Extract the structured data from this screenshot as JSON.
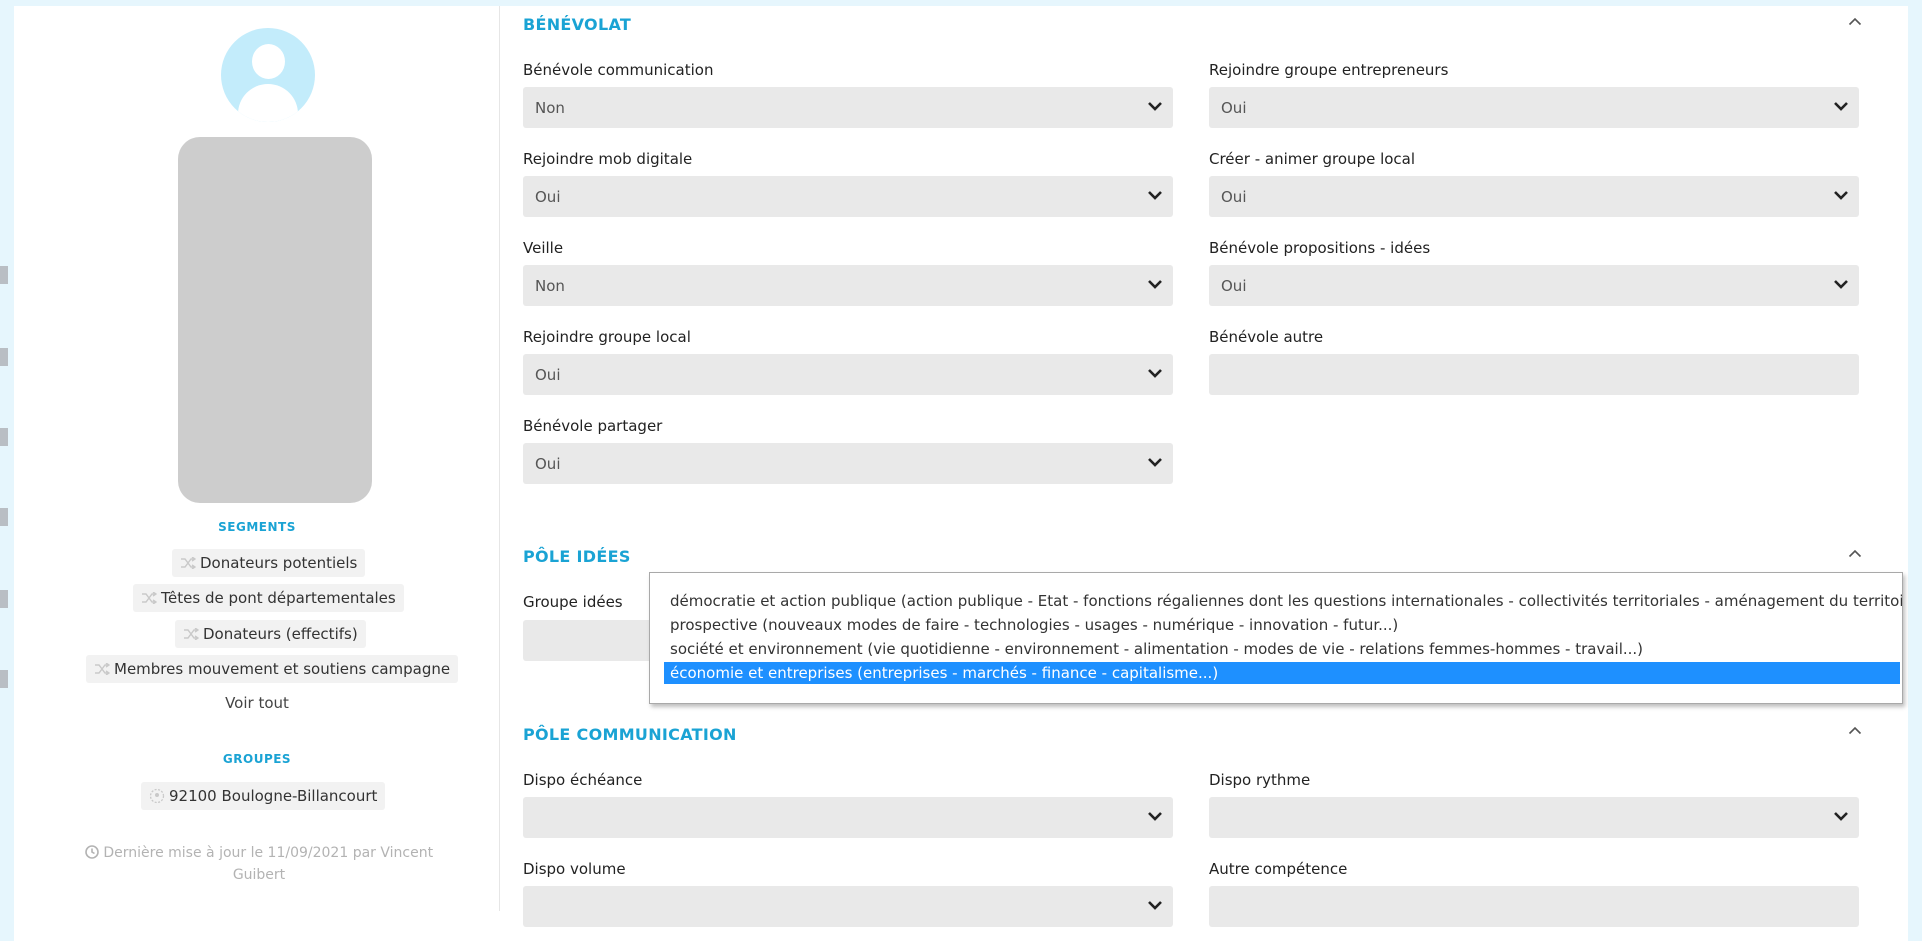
{
  "left": {
    "segments_title": "SEGMENTS",
    "segments": [
      "Donateurs potentiels",
      "Têtes de pont départementales",
      "Donateurs (effectifs)",
      "Membres mouvement et soutiens campagne"
    ],
    "see_all": "Voir tout",
    "groups_title": "GROUPES",
    "groups": [
      "92100 Boulogne-Billancourt"
    ],
    "update_line1": "Dernière mise à jour le 11/09/2021 par Vincent",
    "update_line2": "Guibert"
  },
  "benevolat": {
    "title": "BÉNÉVOLAT",
    "fields": [
      {
        "label": "Bénévole communication",
        "value": "Non"
      },
      {
        "label": "Rejoindre groupe entrepreneurs",
        "value": "Oui"
      },
      {
        "label": "Rejoindre mob digitale",
        "value": "Oui"
      },
      {
        "label": "Créer - animer groupe local",
        "value": "Oui"
      },
      {
        "label": "Veille",
        "value": "Non"
      },
      {
        "label": "Bénévole propositions - idées",
        "value": "Oui"
      },
      {
        "label": "Rejoindre groupe local",
        "value": "Oui"
      },
      {
        "label": "Bénévole autre",
        "value": ""
      },
      {
        "label": "Bénévole partager",
        "value": "Oui"
      }
    ]
  },
  "pole_idees": {
    "title": "PÔLE IDÉES",
    "field_label": "Groupe idées",
    "options": [
      "démocratie et action publique (action publique - Etat - fonctions régaliennes dont les questions internationales - collectivités territoriales - aménagement du territoire...)",
      "prospective (nouveaux modes de faire - technologies - usages - numérique - innovation - futur...)",
      "société et environnement (vie quotidienne - environnement - alimentation - modes de vie - relations femmes-hommes - travail...)",
      "économie et entreprises (entreprises - marchés - finance - capitalisme...)"
    ],
    "selected_index": 3
  },
  "pole_communication": {
    "title": "PÔLE COMMUNICATION",
    "fields": [
      {
        "label": "Dispo échéance",
        "value": ""
      },
      {
        "label": "Dispo rythme",
        "value": ""
      },
      {
        "label": "Dispo volume",
        "value": ""
      },
      {
        "label": "Autre compétence",
        "value": ""
      }
    ]
  },
  "colors": {
    "accent": "#1aa3d4",
    "selected": "#1e90ff",
    "field_bg": "#e9e9e9",
    "page_bg": "#e6f6fd"
  },
  "icons": [
    "avatar-icon",
    "shuffle-icon",
    "group-icon",
    "clock-icon",
    "chevron-down-icon",
    "chevron-up-icon"
  ]
}
